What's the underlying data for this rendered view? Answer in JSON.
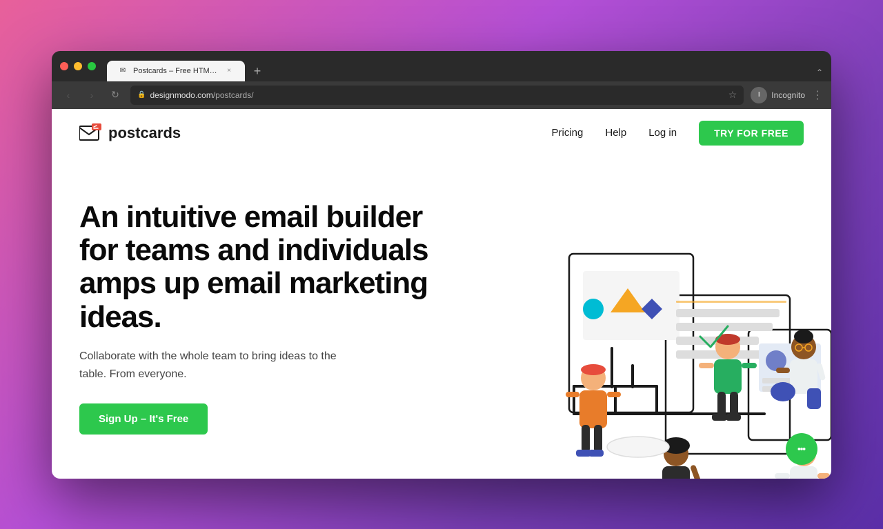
{
  "browser": {
    "traffic_lights": [
      "red",
      "yellow",
      "green"
    ],
    "tab": {
      "favicon": "✉",
      "label": "Postcards – Free HTML Email",
      "close": "×"
    },
    "tab_plus": "+",
    "tab_chevron": "⌃",
    "nav_back": "‹",
    "nav_forward": "›",
    "nav_refresh": "↻",
    "address": {
      "lock": "🔒",
      "url_base": "designmodo.com",
      "url_path": "/postcards/"
    },
    "star": "☆",
    "profile": {
      "label": "Incognito",
      "initial": "I"
    },
    "more": "⋮"
  },
  "nav": {
    "logo_text": "postcards",
    "links": [
      {
        "label": "Pricing",
        "href": "#"
      },
      {
        "label": "Help",
        "href": "#"
      },
      {
        "label": "Log in",
        "href": "#"
      }
    ],
    "cta": "TRY FOR FREE"
  },
  "hero": {
    "title": "An intuitive email builder for teams and individuals amps up email marketing ideas.",
    "subtitle": "Collaborate with the whole team to bring ideas to the table. From everyone.",
    "cta": "Sign Up – It's Free"
  },
  "chat": {
    "icon_label": "chat-icon"
  },
  "colors": {
    "green": "#2dc84d",
    "dark": "#0a0a0a"
  }
}
